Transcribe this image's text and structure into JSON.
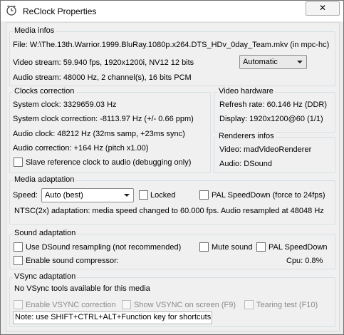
{
  "window": {
    "title": "ReClock Properties",
    "close_glyph": "✕"
  },
  "media_infos": {
    "legend": "Media infos",
    "file": "File:  W:\\The.13th.Warrior.1999.BluRay.1080p.x264.DTS_HDv_0day_Team.mkv (in mpc-hc)",
    "video_stream": "Video stream:  59.940 fps, 1920x1200i, NV12 12 bits",
    "audio_stream": "Audio stream:  48000 Hz, 2 channel(s), 16 bits PCM",
    "mode_select": "Automatic"
  },
  "clocks": {
    "legend": "Clocks correction",
    "system_clock": "System clock: 3329659.03 Hz",
    "system_correction": "System clock correction:  -8113.97 Hz (+/- 0.66 ppm)",
    "audio_clock": "Audio clock:  48212 Hz (32ms samp, +23ms sync)",
    "audio_correction": "Audio correction:  +164 Hz (pitch x1.00)",
    "slave_label": "Slave reference clock to audio (debugging only)"
  },
  "video_hardware": {
    "legend": "Video hardware",
    "refresh": "Refresh rate:  60.146 Hz (DDR)",
    "display": "Display:  1920x1200@60 (1/1)"
  },
  "renderers": {
    "legend": "Renderers infos",
    "video": "Video: madVideoRenderer",
    "audio": "Audio: DSound"
  },
  "media_adaptation": {
    "legend": "Media adaptation",
    "speed_label": "Speed:",
    "speed_value": "Auto (best)",
    "locked_label": "Locked",
    "pal_label": "PAL SpeedDown (force to 24fps)",
    "status": "NTSC(2x) adaptation: media speed changed to 60.000 fps. Audio resampled at 48048 Hz"
  },
  "sound_adaptation": {
    "legend": "Sound adaptation",
    "dsound_label": "Use DSound resampling (not recommended)",
    "mute_label": "Mute sound",
    "pal_label": "PAL SpeedDown",
    "compressor_label": "Enable sound compressor:",
    "cpu": "Cpu:  0.8%"
  },
  "vsync": {
    "legend": "VSync adaptation",
    "status": "No VSync tools available for this media",
    "enable_label": "Enable VSYNC correction",
    "show_label": "Show VSYNC on screen (F9)",
    "tearing_label": "Tearing test (F10)",
    "note": "Note: use SHIFT+CTRL+ALT+Function key for shortcuts"
  }
}
